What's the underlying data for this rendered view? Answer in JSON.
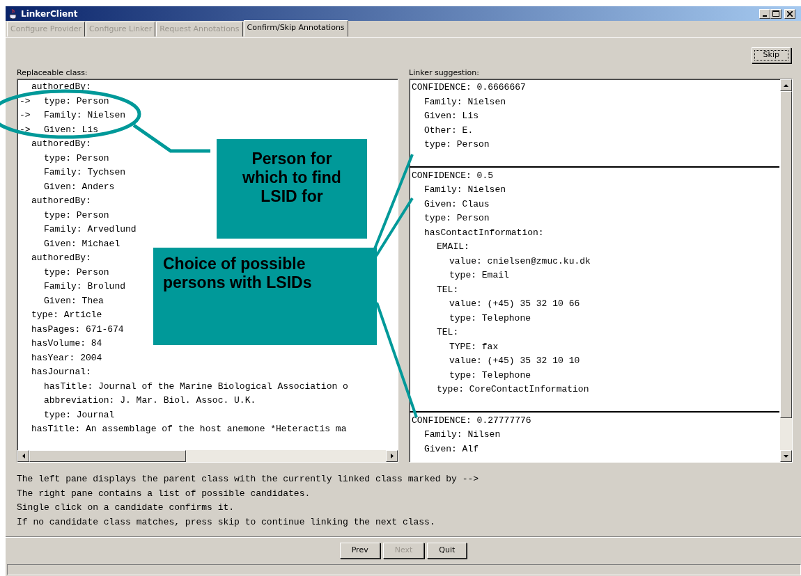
{
  "window": {
    "title": "LinkerClient"
  },
  "tabs": [
    {
      "label": "Configure Provider",
      "selected": false,
      "disabled": true
    },
    {
      "label": "Configure Linker",
      "selected": false,
      "disabled": true
    },
    {
      "label": "Request Annotations",
      "selected": false,
      "disabled": true
    },
    {
      "label": "Confirm/Skip Annotations",
      "selected": true,
      "disabled": false
    }
  ],
  "skip_button": {
    "label": "Skip"
  },
  "replaceable_class": {
    "label": "Replaceable class:",
    "items": [
      {
        "text": "authoredBy:",
        "children": [
          {
            "text": "type: Person",
            "marker": "->"
          },
          {
            "text": "Family: Nielsen",
            "marker": "->"
          },
          {
            "text": "Given: Lis",
            "marker": "->"
          }
        ]
      },
      {
        "text": "authoredBy:",
        "children": [
          {
            "text": "type: Person"
          },
          {
            "text": "Family: Tychsen"
          },
          {
            "text": "Given: Anders"
          }
        ]
      },
      {
        "text": "authoredBy:",
        "children": [
          {
            "text": "type: Person"
          },
          {
            "text": "Family: Arvedlund"
          },
          {
            "text": "Given: Michael"
          }
        ]
      },
      {
        "text": "authoredBy:",
        "children": [
          {
            "text": "type: Person"
          },
          {
            "text": "Family: Brolund"
          },
          {
            "text": "Given: Thea"
          }
        ]
      },
      {
        "text": "type: Article"
      },
      {
        "text": "hasPages: 671-674"
      },
      {
        "text": "hasVolume: 84"
      },
      {
        "text": "hasYear: 2004"
      },
      {
        "text": "hasJournal:",
        "children": [
          {
            "text": "hasTitle: Journal of the Marine Biological Association o"
          },
          {
            "text": "abbreviation: J. Mar. Biol. Assoc. U.K."
          },
          {
            "text": "type: Journal"
          }
        ]
      },
      {
        "text": "hasTitle: An assemblage of the host anemone *Heteractis ma"
      }
    ]
  },
  "linker_suggestion": {
    "label": "Linker suggestion:",
    "candidates": [
      {
        "text": "CONFIDENCE: 0.6666667",
        "children": [
          {
            "text": "Family: Nielsen"
          },
          {
            "text": "Given: Lis"
          },
          {
            "text": "Other: E."
          },
          {
            "text": "type: Person"
          }
        ]
      },
      {
        "text": "CONFIDENCE: 0.5",
        "children": [
          {
            "text": "Family: Nielsen"
          },
          {
            "text": "Given: Claus"
          },
          {
            "text": "type: Person"
          },
          {
            "text": "hasContactInformation:",
            "children": [
              {
                "text": "EMAIL:",
                "children": [
                  {
                    "text": "value: cnielsen@zmuc.ku.dk"
                  },
                  {
                    "text": "type: Email"
                  }
                ]
              },
              {
                "text": "TEL:",
                "children": [
                  {
                    "text": "value: (+45) 35 32 10 66"
                  },
                  {
                    "text": "type: Telephone"
                  }
                ]
              },
              {
                "text": "TEL:",
                "children": [
                  {
                    "text": "TYPE: fax"
                  },
                  {
                    "text": "value: (+45) 35 32 10 10"
                  },
                  {
                    "text": "type: Telephone"
                  }
                ]
              },
              {
                "text": "type: CoreContactInformation"
              }
            ]
          }
        ]
      },
      {
        "text": "CONFIDENCE: 0.27777776",
        "children": [
          {
            "text": "Family: Nilsen"
          },
          {
            "text": "Given: Alf"
          }
        ]
      }
    ]
  },
  "help_lines": [
    "The left pane displays the parent class with the currently linked class marked by -->",
    "The right pane contains a list of possible candidates.",
    "Single click on a candidate confirms it.",
    "If no candidate class matches, press skip to continue linking the next class."
  ],
  "buttons": [
    {
      "label": "Prev",
      "disabled": false
    },
    {
      "label": "Next",
      "disabled": true
    },
    {
      "label": "Quit",
      "disabled": false
    }
  ],
  "callouts": [
    {
      "text": "Person for which to find LSID for"
    },
    {
      "text": "Choice of possible persons with LSIDs"
    }
  ]
}
